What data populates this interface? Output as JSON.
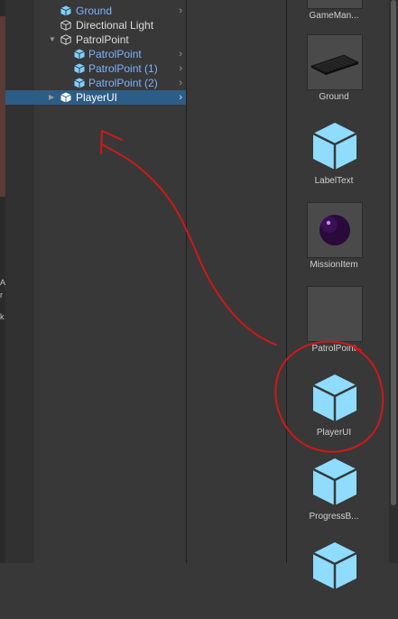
{
  "hierarchy": {
    "items": [
      {
        "label": "Ground",
        "style": "prefab"
      },
      {
        "label": "Directional Light",
        "style": "object"
      },
      {
        "label": "PatrolPoint",
        "style": "object"
      },
      {
        "label": "PatrolPoint",
        "style": "prefab"
      },
      {
        "label": "PatrolPoint (1)",
        "style": "prefab"
      },
      {
        "label": "PatrolPoint (2)",
        "style": "prefab"
      },
      {
        "label": "PlayerUI",
        "style": "prefab",
        "selected": true
      }
    ]
  },
  "assets": {
    "items": [
      {
        "label": "GameMan...",
        "kind": "partial"
      },
      {
        "label": "Ground",
        "kind": "plane"
      },
      {
        "label": "LabelText",
        "kind": "cube"
      },
      {
        "label": "MissionItem",
        "kind": "sphere"
      },
      {
        "label": "PatrolPoint",
        "kind": "empty"
      },
      {
        "label": "PlayerUI",
        "kind": "cube"
      },
      {
        "label": "ProgressB...",
        "kind": "cube"
      }
    ]
  },
  "left_strip_glyphs": [
    "A",
    "r",
    "k"
  ],
  "colors": {
    "selection": "#2c5d87",
    "prefab_text": "#7cb3ff",
    "prefab_icon": "#7fd0ff",
    "annotation": "#d01818"
  },
  "icons": {
    "prefab": "prefab-cube-icon",
    "object": "gameobject-cube-icon",
    "fold_open": "triangle-down-icon",
    "fold_closed": "triangle-right-icon",
    "chevron": "chevron-right-icon"
  }
}
